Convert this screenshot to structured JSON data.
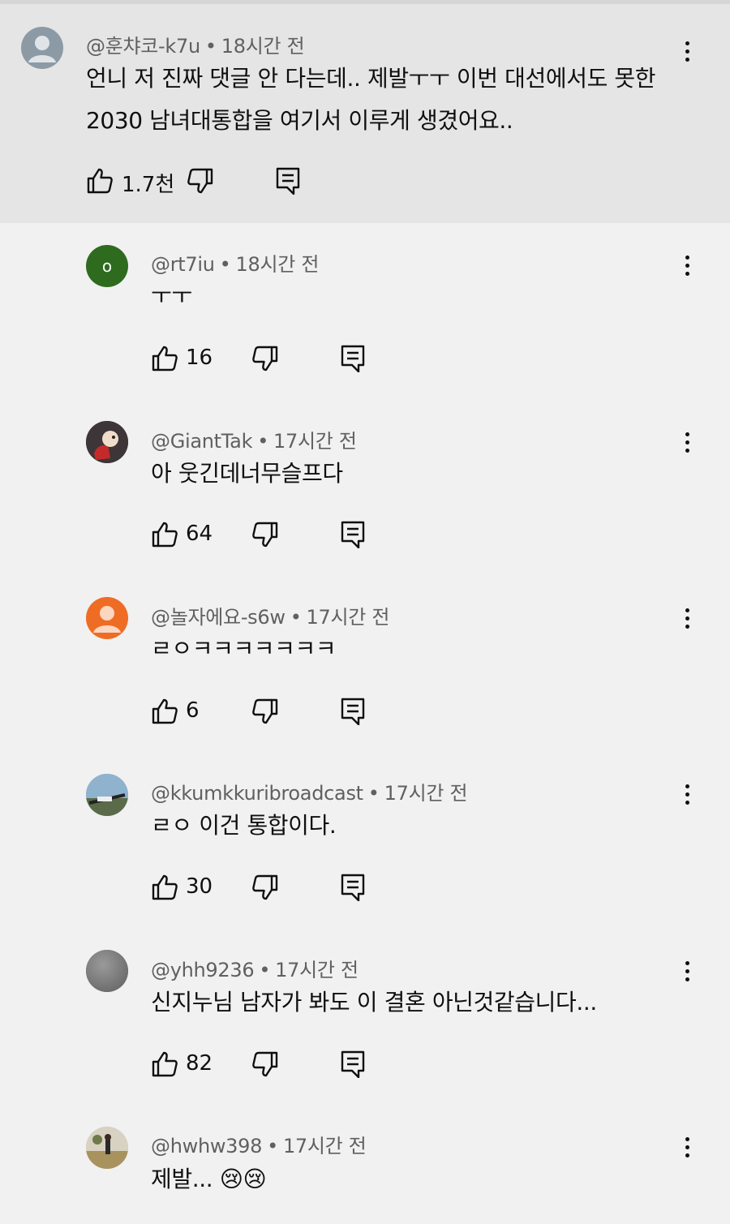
{
  "comments": [
    {
      "author": "@훈챠코-k7u",
      "time": "18시간 전",
      "text": "언니 저 진짜 댓글 안 다는데.. 제발ㅜㅜ 이번 대선에서도 못한 2030 남녀대통합을 여기서 이루게 생겼어요..",
      "text_lines": [
        "언니 저 진짜 댓글 안 다는데.. 제발ㅜㅜ 이번 대선에서도 못한",
        "2030 남녀대통합을 여기서 이루게 생겼어요.."
      ],
      "likes": "1.7천",
      "avatar": "default-person-gray",
      "highlighted": true
    },
    {
      "author": "@rt7iu",
      "time": "18시간 전",
      "text": "ㅜㅜ",
      "likes": "16",
      "avatar": "letter-o-green",
      "avatar_letter": "o"
    },
    {
      "author": "@GiantTak",
      "time": "17시간 전",
      "text": "아 웃긴데너무슬프다",
      "likes": "64",
      "avatar": "photo-figure-red"
    },
    {
      "author": "@놀자에요-s6w",
      "time": "17시간 전",
      "text": "ㄹㅇㅋㅋㅋㅋㅋㅋㅋ",
      "likes": "6",
      "avatar": "default-person-orange"
    },
    {
      "author": "@kkumkkuribroadcast",
      "time": "17시간 전",
      "text": "ㄹㅇ 이건 통합이다.",
      "likes": "30",
      "avatar": "photo-sky-landscape"
    },
    {
      "author": "@yhh9236",
      "time": "17시간 전",
      "text": "신지누님 남자가 봐도 이 결혼 아닌것같습니다...",
      "likes": "82",
      "avatar": "gray-circle"
    },
    {
      "author": "@hwhw398",
      "time": "17시간 전",
      "text": "제발... 😢😢",
      "likes": "",
      "avatar": "photo-person-field"
    }
  ],
  "colors": {
    "background": "#f1f1f1",
    "highlight": "#e5e5e5",
    "meta_text": "#606060",
    "text": "#0f0f0f",
    "avatar_green": "#2e6b1e",
    "avatar_orange": "#ef6c24",
    "avatar_gray": "#8c9aa6"
  },
  "icons": [
    "like-icon",
    "dislike-icon",
    "reply-icon",
    "more-options-icon"
  ]
}
